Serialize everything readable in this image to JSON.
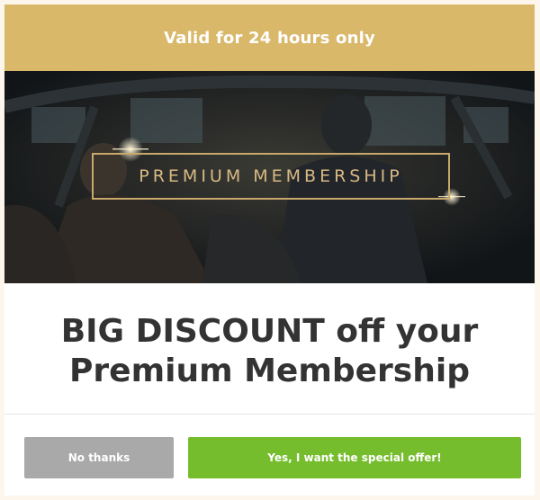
{
  "banner": {
    "text": "Valid for 24 hours only"
  },
  "hero": {
    "frame_text": "PREMIUM MEMBERSHIP"
  },
  "headline": {
    "line1": "BIG DISCOUNT off your",
    "line2": "Premium Membership"
  },
  "buttons": {
    "no_label": "No thanks",
    "yes_label": "Yes, I want the special offer!"
  },
  "colors": {
    "banner": "#d9b86a",
    "accent_gold": "#c9a86b",
    "no_button": "#a9a9a9",
    "yes_button": "#76bd2e",
    "headline_text": "#333333"
  }
}
